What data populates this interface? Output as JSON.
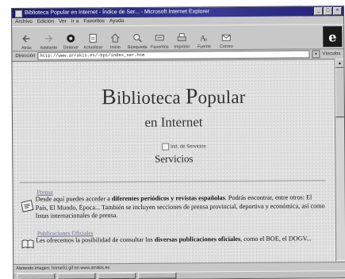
{
  "window": {
    "title": "Biblioteca Popular en Internet - Índice de Ser... - Microsoft Internet Explorer",
    "controls": [
      "_",
      "□",
      "×"
    ]
  },
  "menu": [
    "Archivo",
    "Edición",
    "Ver",
    "Ir a",
    "Favoritos",
    "Ayuda"
  ],
  "toolbar": {
    "buttons": [
      {
        "label": "Atrás",
        "icon": "back-arrow-icon"
      },
      {
        "label": "Adelante",
        "icon": "forward-arrow-icon"
      },
      {
        "label": "Detener",
        "icon": "stop-icon"
      },
      {
        "label": "Actualizar",
        "icon": "refresh-icon"
      },
      {
        "label": "Inicio",
        "icon": "home-icon"
      },
      {
        "label": "Búsqueda",
        "icon": "search-icon"
      },
      {
        "label": "Favoritos",
        "icon": "favorites-icon"
      },
      {
        "label": "Imprimir",
        "icon": "print-icon"
      },
      {
        "label": "Fuente",
        "icon": "font-icon"
      },
      {
        "label": "Correo",
        "icon": "mail-icon"
      }
    ],
    "brand_letter": "e"
  },
  "address": {
    "label": "Dirección",
    "value": "http://www.arrakis.es/~bpi/index_ser.htm",
    "links_label": "Vínculos"
  },
  "page": {
    "title_first_cap": "B",
    "title_word1_rest": "iblioteca ",
    "title_second_cap": "P",
    "title_word2_rest": "opular",
    "subtitle": "en Internet",
    "services_image_label": "Ind. de Servicios",
    "services_heading": "Servicios",
    "sections": [
      {
        "heading": "Prensa",
        "text_before": "Desde aquí puedes acceder a ",
        "text_bold": "diferentes periódicos y revistas españolas",
        "text_after": ". Podrás encontrar, entre otros: El País, El Mundo, Época... También se incluyen secciones de prensa provincial, deportiva y económica, así como listas internacionales de prensa."
      },
      {
        "heading": "Publicaciones Oficiales",
        "text_before": "Les ofrecemos la posibilidad de consultar los ",
        "text_bold": "diversas publicaciones oficiales",
        "text_after": ", como el BOE, el DOGV..."
      }
    ]
  },
  "status": {
    "text": "Abriendo imagen: home01.gif en www.arrakis.es"
  },
  "colors": {
    "titlebar": "#2a2a80",
    "chrome": "#c8c8c8",
    "page_bg": "#e0e0e0",
    "link": "#6a6a8a"
  }
}
